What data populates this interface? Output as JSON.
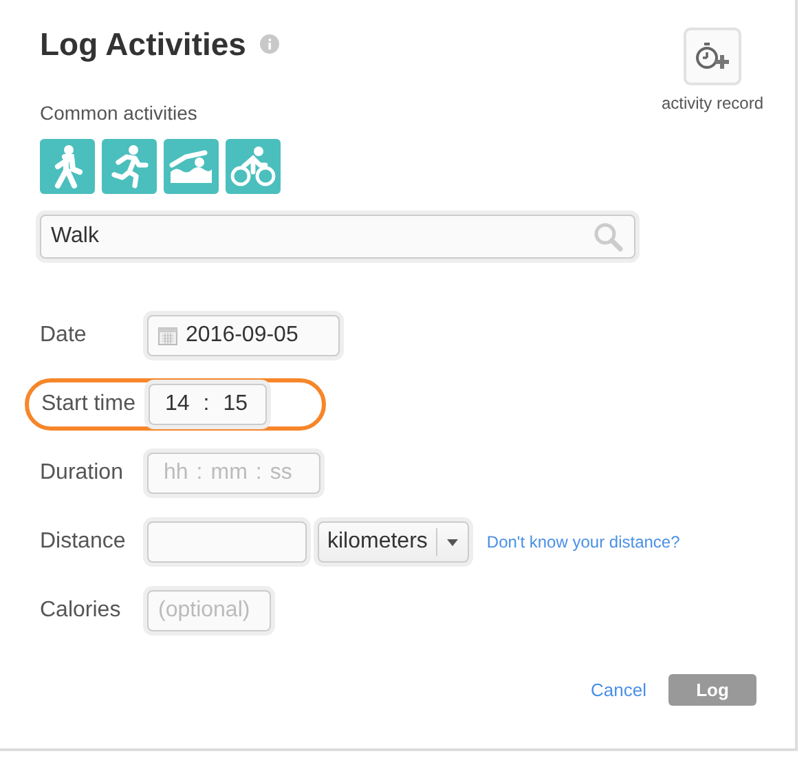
{
  "title": "Log Activities",
  "record_button": {
    "label": "activity record"
  },
  "common": {
    "label": "Common activities",
    "activities": [
      {
        "kind": "walk"
      },
      {
        "kind": "run"
      },
      {
        "kind": "swim"
      },
      {
        "kind": "bike"
      }
    ]
  },
  "search": {
    "value": "Walk"
  },
  "rows": [
    {
      "kind": "date",
      "label": "Date",
      "value": "2016-09-05",
      "highlighted": false
    },
    {
      "kind": "time",
      "label": "Start time",
      "parts": [
        "14",
        ":",
        "15"
      ],
      "highlighted": true
    },
    {
      "kind": "duration",
      "label": "Duration",
      "parts": [
        "hh",
        ":",
        "mm",
        ":",
        "ss"
      ],
      "highlighted": false
    },
    {
      "kind": "distance",
      "label": "Distance",
      "unit": "kilometers",
      "link": "Don't know your distance?",
      "highlighted": false
    },
    {
      "kind": "text",
      "label": "Calories",
      "placeholder": "(optional)",
      "highlighted": false
    }
  ],
  "buttons": {
    "cancel": "Cancel",
    "log": "Log"
  }
}
